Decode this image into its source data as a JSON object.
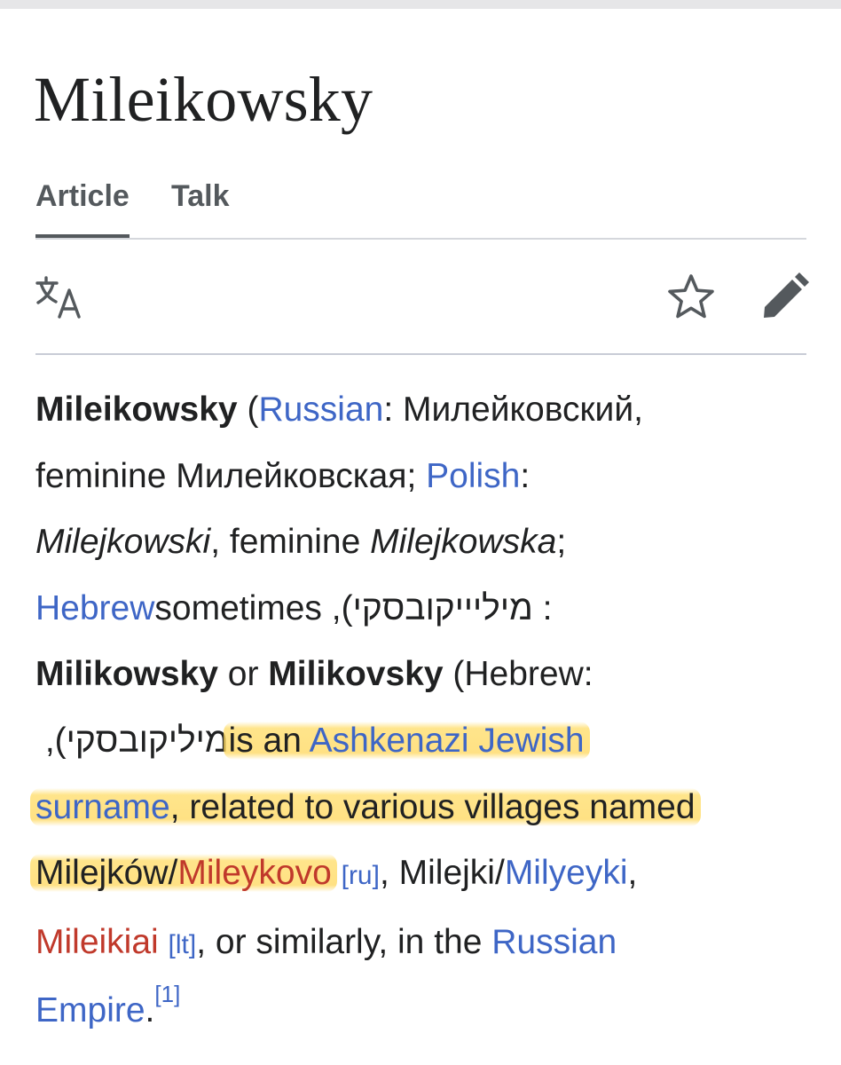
{
  "page": {
    "title": "Mileikowsky"
  },
  "tabs": [
    {
      "label": "Article",
      "active": true
    },
    {
      "label": "Talk",
      "active": false
    }
  ],
  "toolbar": {
    "icons": [
      "language-icon",
      "star-icon",
      "edit-pencil-icon"
    ]
  },
  "article": {
    "line1": {
      "bold": "Mileikowsky",
      "open_paren": " (",
      "lang1": "Russian",
      "colon": ": Милейковский,"
    },
    "line2": {
      "text": "feminine Милейковская; ",
      "lang2": "Polish",
      "colon": ":"
    },
    "line3": {
      "italic1": "Milejkowski",
      "mid": ", feminine ",
      "italic2": "Milejkowska",
      "semi": ";"
    },
    "line4": {
      "lang3": "Hebrew",
      "rest": ": מיליייקובסקי), sometimes"
    },
    "line5": {
      "bold1": "Milikowsky",
      "or": " or ",
      "bold2": "Milikovsky",
      "rest": " (Hebrew:"
    },
    "line6": {
      "hebrew": "מיליקובסקי), ",
      "plain": "is an ",
      "link": "Ashkenazi Jewish"
    },
    "line7": {
      "link": "surname",
      "rest": ", related to various villages named"
    },
    "line8": {
      "t1": "Milejków/",
      "red1": "Mileykovo",
      "sp": " ",
      "ru": "[ru]",
      "t2": ", Milejki/",
      "link": "Milyeyki",
      "comma": ","
    },
    "line9": {
      "red2": "Mileikiai",
      "sp": " ",
      "lt": "[lt]",
      "rest": ", or similarly, in the ",
      "link": "Russian"
    },
    "line10": {
      "link": "Empire",
      "dot": ".",
      "ref": "[1]"
    }
  },
  "colors": {
    "link": "#3e66c6",
    "redlink": "#c0392b",
    "highlight": "#ffe070",
    "text": "#202122"
  }
}
